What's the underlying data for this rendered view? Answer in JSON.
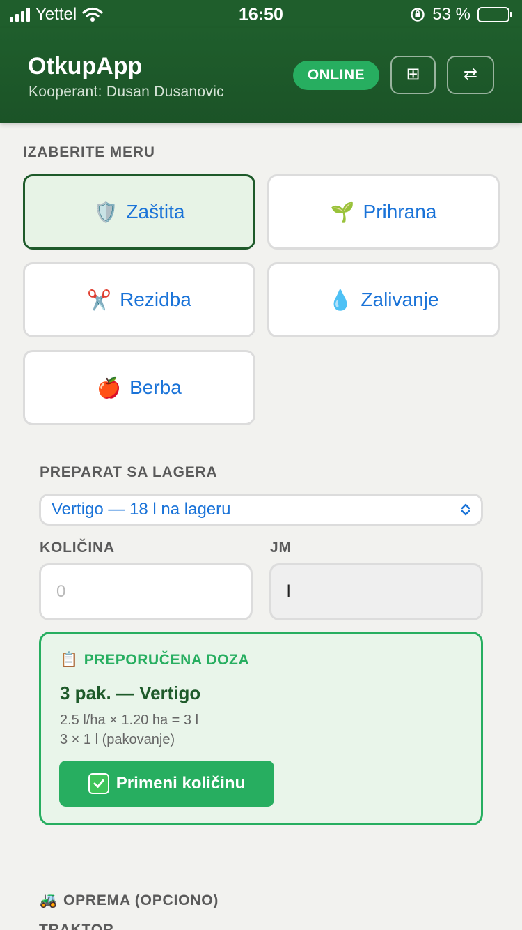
{
  "status_bar": {
    "carrier": "Yettel",
    "time": "16:50",
    "battery": "53 %",
    "battery_level": 0.53
  },
  "header": {
    "title": "OtkupApp",
    "subtitle": "Kooperant: Dusan Dusanovic",
    "status_badge": "ONLINE",
    "grid_button": "⊞",
    "swap_button": "⇄"
  },
  "measures": {
    "label": "IZABERITE MERU",
    "items": [
      {
        "icon": "🛡️",
        "icon_name": "shield-icon",
        "label": "Zaštita",
        "selected": true
      },
      {
        "icon": "🌱",
        "icon_name": "seedling-icon",
        "label": "Prihrana",
        "selected": false
      },
      {
        "icon": "✂️",
        "icon_name": "scissors-icon",
        "label": "Rezidba",
        "selected": false
      },
      {
        "icon": "💧",
        "icon_name": "droplet-icon",
        "label": "Zalivanje",
        "selected": false
      },
      {
        "icon": "🍎",
        "icon_name": "apple-icon",
        "label": "Berba",
        "selected": false
      }
    ]
  },
  "preparat": {
    "label": "PREPARAT SA LAGERA",
    "selected": "Vertigo — 18 l na lageru"
  },
  "quantity": {
    "label": "KOLIČINA",
    "placeholder": "0",
    "unit_label": "JM",
    "unit_value": "l"
  },
  "dose": {
    "header": "PREPORUČENA DOZA",
    "title": "3 pak. — Vertigo",
    "line1": "2.5 l/ha × 1.20 ha = 3 l",
    "line2": "3 × 1 l (pakovanje)",
    "button": "Primeni količinu"
  },
  "equipment": {
    "label": "OPREMA (OPCIONO)",
    "tractor_label": "TRAKTOR"
  },
  "colors": {
    "primary_dark": "#1f5e2c",
    "accent_green": "#27ae60",
    "link_blue": "#1a73d8"
  }
}
